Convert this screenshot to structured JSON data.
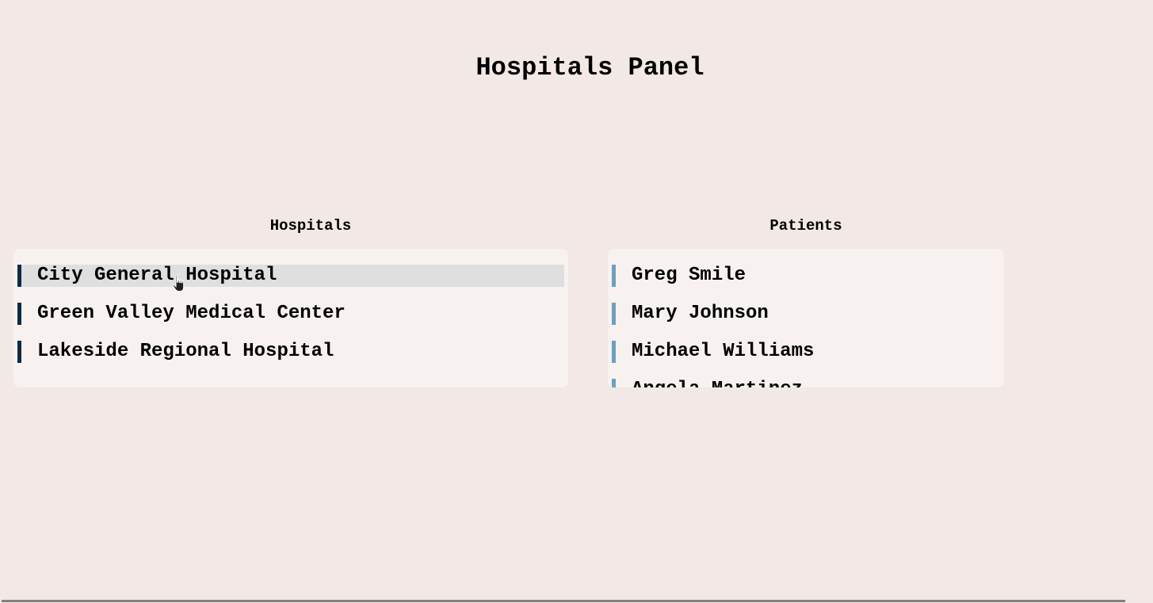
{
  "page": {
    "title": "Hospitals Panel"
  },
  "hospitals": {
    "heading": "Hospitals",
    "items": [
      {
        "label": "City General Hospital",
        "selected": true
      },
      {
        "label": "Green Valley Medical Center",
        "selected": false
      },
      {
        "label": "Lakeside Regional Hospital",
        "selected": false
      }
    ]
  },
  "patients": {
    "heading": "Patients",
    "items": [
      {
        "label": "Greg Smile"
      },
      {
        "label": "Mary Johnson"
      },
      {
        "label": "Michael Williams"
      },
      {
        "label": "Angela Martinez"
      }
    ]
  },
  "colors": {
    "background": "#f2e8e5",
    "panel": "#f7f2f0",
    "hospital_accent": "#0d2a47",
    "patient_accent": "#6e9fbd",
    "selected_row": "#dfdfdf"
  },
  "icons": {
    "cursor": "hand-pointer-icon"
  }
}
